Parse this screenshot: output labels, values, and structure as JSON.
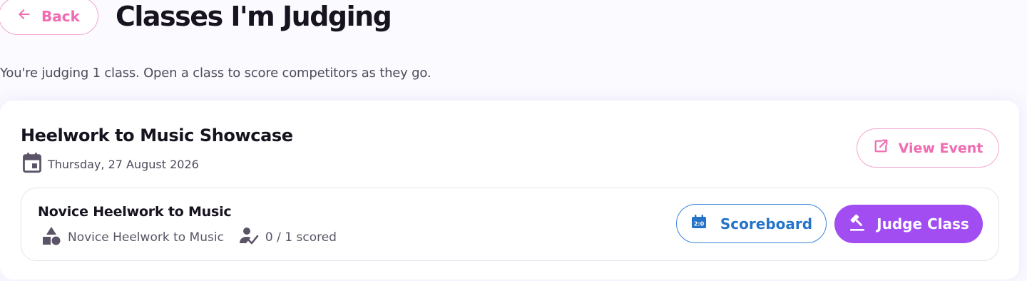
{
  "header": {
    "back_label": "Back",
    "title": "Classes I'm Judging"
  },
  "subtitle": "You're judging 1 class. Open a class to score competitors as they go.",
  "event": {
    "title": "Heelwork to Music Showcase",
    "date": "Thursday, 27 August 2026",
    "view_event_label": "View Event",
    "classes": [
      {
        "name": "Novice Heelwork to Music",
        "category": "Novice Heelwork to Music",
        "scored": "0 / 1 scored",
        "scoreboard_label": "Scoreboard",
        "judge_label": "Judge Class"
      }
    ]
  },
  "icons": {
    "back": "arrow-left-icon",
    "date": "calendar-icon",
    "view_event": "external-link-icon",
    "category": "shapes-icon",
    "scored": "person-check-icon",
    "scoreboard": "scoreboard-icon",
    "judge": "gavel-icon"
  },
  "colors": {
    "pink_accent": "#f06bb0",
    "blue_accent": "#2473c8",
    "purple_primary": "#a24df2",
    "text_dark": "#17131f",
    "text_muted": "#5a5566",
    "icon_muted": "#5b5366"
  }
}
